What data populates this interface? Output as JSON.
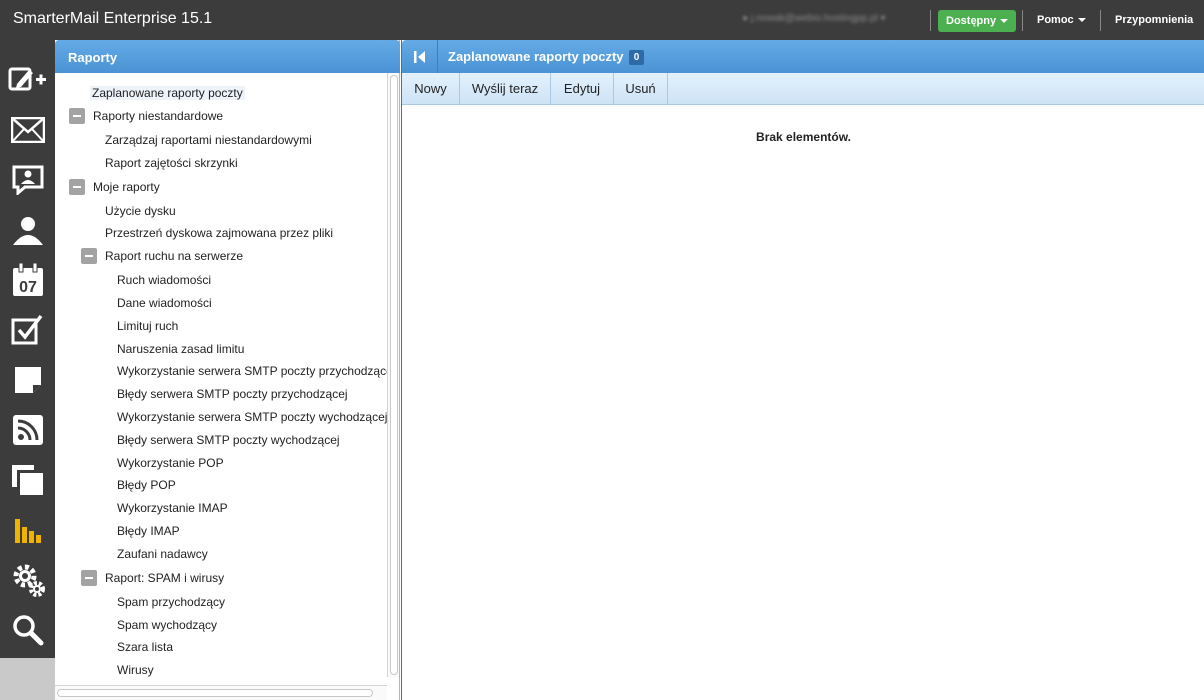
{
  "app": {
    "title": "SmarterMail Enterprise 15.1"
  },
  "topbar": {
    "user_email": "j.nowak@webio.hostingpp.pl",
    "status_label": "Dostępny",
    "help_label": "Pomoc",
    "reminders_label": "Przypomnienia"
  },
  "rail": {
    "items": [
      {
        "icon": "compose-icon"
      },
      {
        "icon": "mail-icon"
      },
      {
        "icon": "chat-icon"
      },
      {
        "icon": "contacts-icon"
      },
      {
        "icon": "calendar-icon",
        "text": "07"
      },
      {
        "icon": "tasks-icon"
      },
      {
        "icon": "notes-icon"
      },
      {
        "icon": "rss-icon"
      },
      {
        "icon": "files-icon"
      },
      {
        "icon": "reports-icon"
      },
      {
        "icon": "settings-icon"
      },
      {
        "icon": "search-icon"
      }
    ],
    "active_icon": "reports-icon",
    "accent": "#f0b400"
  },
  "left_panel": {
    "title": "Raporty",
    "tree": [
      {
        "label": "Zaplanowane raporty poczty",
        "selected": true
      },
      {
        "label": "Raporty niestandardowe",
        "toggle": true
      },
      {
        "label": "Zarządzaj raportami niestandardowymi"
      },
      {
        "label": "Raport zajętości skrzynki"
      },
      {
        "label": "Moje raporty",
        "toggle": true
      },
      {
        "label": "Użycie dysku"
      },
      {
        "label": "Przestrzeń dyskowa zajmowana przez pliki"
      },
      {
        "label": "Raport ruchu na serwerze",
        "toggle": true
      },
      {
        "label": "Ruch wiadomości"
      },
      {
        "label": "Dane wiadomości"
      },
      {
        "label": "Limituj ruch"
      },
      {
        "label": "Naruszenia zasad limitu"
      },
      {
        "label": "Wykorzystanie serwera SMTP poczty przychodzącej"
      },
      {
        "label": "Błędy serwera SMTP poczty przychodzącej"
      },
      {
        "label": "Wykorzystanie serwera SMTP poczty wychodzącej"
      },
      {
        "label": "Błędy serwera SMTP poczty wychodzącej"
      },
      {
        "label": "Wykorzystanie POP"
      },
      {
        "label": "Błędy POP"
      },
      {
        "label": "Wykorzystanie IMAP"
      },
      {
        "label": "Błędy IMAP"
      },
      {
        "label": "Zaufani nadawcy"
      },
      {
        "label": "Raport: SPAM i wirusy",
        "toggle": true
      },
      {
        "label": "Spam przychodzący"
      },
      {
        "label": "Spam wychodzący"
      },
      {
        "label": "Szara lista"
      },
      {
        "label": "Wirusy"
      }
    ]
  },
  "right_panel": {
    "title": "Zaplanowane raporty poczty",
    "count": "0",
    "toolbar": {
      "new_label": "Nowy",
      "send_now_label": "Wyślij teraz",
      "edit_label": "Edytuj",
      "delete_label": "Usuń"
    },
    "empty_message": "Brak elementów."
  }
}
